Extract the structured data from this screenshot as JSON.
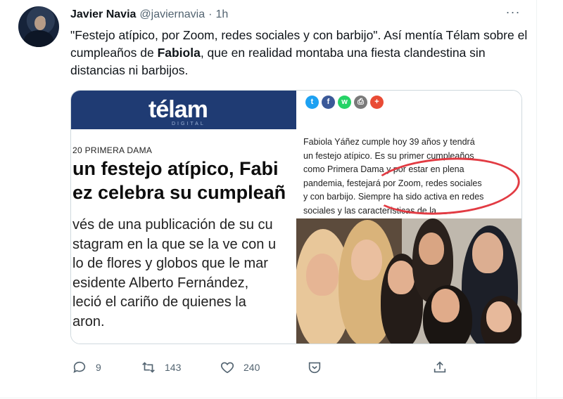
{
  "tweet": {
    "author_name": "Javier Navia",
    "handle": "@javiernavia",
    "separator": "·",
    "time": "1h",
    "more": "···",
    "text_before": "\"Festejo atípico, por Zoom, redes sociales y con barbijo\". Así mentía Télam sobre el cumpleaños de ",
    "text_bold": "Fabiola",
    "text_after": ", que en realidad montaba una fiesta clandestina sin distancias ni barbijos."
  },
  "media": {
    "left": {
      "logo": "télam",
      "logo_sub": "DIGITAL",
      "section": "20 PRIMERA DAMA",
      "headline_1": "un festejo atípico, Fabi",
      "headline_2": "ez celebra su cumpleañ",
      "lead_1": "vés de una publicación de su cu",
      "lead_2": "stagram en la que se la ve con u",
      "lead_3": "lo de flores y globos que le mar",
      "lead_4": "esidente Alberto Fernández,",
      "lead_5": "leció el cariño de quienes la",
      "lead_6": "aron."
    },
    "right": {
      "share_icons": [
        "twitter-icon",
        "facebook-icon",
        "whatsapp-icon",
        "print-icon",
        "plus-icon"
      ],
      "share_colors": [
        "#1da1f2",
        "#3b5998",
        "#25d366",
        "#7a7a7a",
        "#e94b35"
      ],
      "share_glyphs": [
        "t",
        "f",
        "w",
        "⎙",
        "+"
      ],
      "line_1": "Fabiola Yáñez  cumple  hoy 39 años y tendrá",
      "line_2": "un festejo atípico. Es su primer cumpleaños",
      "line_3": "como Primera Dama y por estar en plena",
      "line_4": "pandemia, festejará por Zoom, redes sociales",
      "line_5": "y con barbijo. Siempre ha sido activa en redes",
      "line_6": "sociales y las características de la"
    }
  },
  "actions": {
    "reply_count": "9",
    "retweet_count": "143",
    "like_count": "240"
  },
  "colors": {
    "muted": "#536471",
    "telam_blue": "#1f3b73",
    "red_mark": "#e23b43"
  }
}
